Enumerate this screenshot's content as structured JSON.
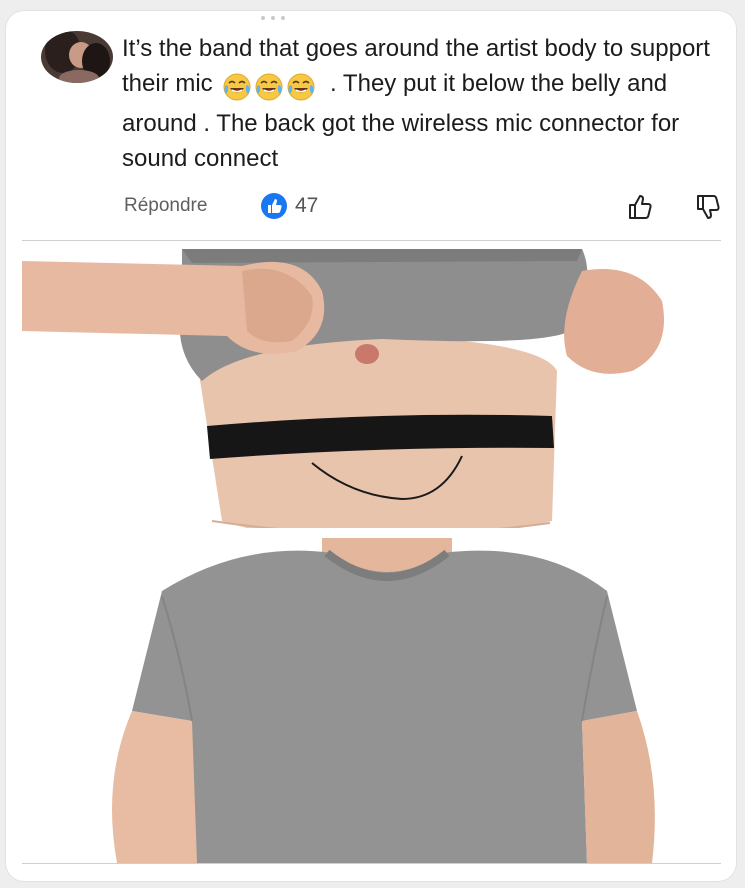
{
  "comment": {
    "text_part1": "It’s the band that goes around the artist body to support their mic",
    "text_part2": ". They put it below the belly and around . The back got the wireless mic connector for sound connect",
    "emojis": [
      "face-with-tears-of-joy",
      "face-with-tears-of-joy",
      "face-with-tears-of-joy"
    ]
  },
  "actions": {
    "reply_label": "Répondre",
    "like_count": "47",
    "like_icon": "thumbs-up-icon",
    "like_color": "#1877f2",
    "upvote_icon": "thumbs-up-outline-icon",
    "downvote_icon": "thumbs-down-outline-icon"
  },
  "image": {
    "panels": [
      "person lifting grey t-shirt showing black elastic chest band with thin cable",
      "person wearing grey t-shirt covering the band"
    ]
  }
}
